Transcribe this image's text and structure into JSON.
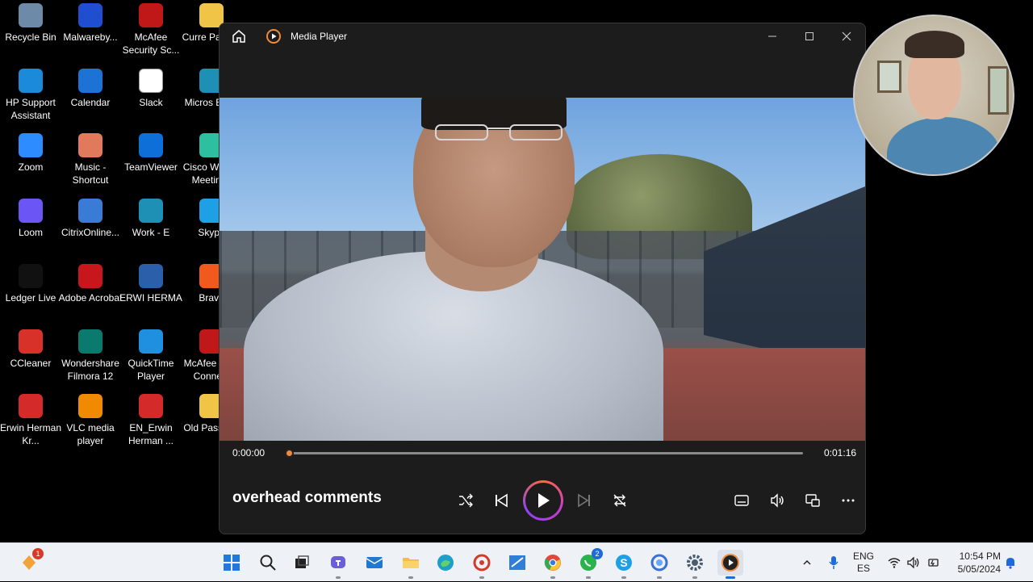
{
  "desktop": {
    "icons": [
      {
        "label": "Recycle Bin",
        "icon": "recycle-bin-icon",
        "color": "#6d8ba8"
      },
      {
        "label": "Malwareby...",
        "icon": "malwarebytes-icon",
        "color": "#1f4fd0"
      },
      {
        "label": "McAfee Security Sc...",
        "icon": "mcafee-icon",
        "color": "#c01818"
      },
      {
        "label": "Curre Passsp",
        "icon": "folder-icon",
        "color": "#f0c447"
      },
      {
        "label": "HP Support Assistant",
        "icon": "hp-support-icon",
        "color": "#1b8ad8"
      },
      {
        "label": "Calendar",
        "icon": "calendar-icon",
        "color": "#1d72d6"
      },
      {
        "label": "Slack",
        "icon": "slack-icon",
        "color": "#ffffff"
      },
      {
        "label": "Micros Edge",
        "icon": "edge-icon",
        "color": "#1e8fb5"
      },
      {
        "label": "Zoom",
        "icon": "zoom-icon",
        "color": "#2d8cff"
      },
      {
        "label": "Music - Shortcut",
        "icon": "music-folder-icon",
        "color": "#e07a5a"
      },
      {
        "label": "TeamViewer",
        "icon": "teamviewer-icon",
        "color": "#0e6fd8"
      },
      {
        "label": "Cisco Webex Meetings",
        "icon": "webex-icon",
        "color": "#2cc0a0"
      },
      {
        "label": "Loom",
        "icon": "loom-icon",
        "color": "#6c55f5"
      },
      {
        "label": "CitrixOnline...",
        "icon": "citrix-icon",
        "color": "#3a7bd5"
      },
      {
        "label": "Work - E",
        "icon": "edge-work-icon",
        "color": "#1e8fb5"
      },
      {
        "label": "Skype",
        "icon": "skype-icon",
        "color": "#1da0e6"
      },
      {
        "label": "Ledger Live",
        "icon": "ledger-icon",
        "color": "#111111"
      },
      {
        "label": "Adobe Acrobat",
        "icon": "acrobat-icon",
        "color": "#c8161d"
      },
      {
        "label": "ERWI HERMA",
        "icon": "word-doc-icon",
        "color": "#2b5faa"
      },
      {
        "label": "Brave",
        "icon": "brave-icon",
        "color": "#f25a1d"
      },
      {
        "label": "CCleaner",
        "icon": "ccleaner-icon",
        "color": "#d8312a"
      },
      {
        "label": "Wondershare Filmora 12",
        "icon": "filmora-icon",
        "color": "#0a7a6e"
      },
      {
        "label": "QuickTime Player",
        "icon": "quicktime-icon",
        "color": "#1f8fe0"
      },
      {
        "label": "McAfee Safe Connect",
        "icon": "mcafee-safe-icon",
        "color": "#c01818"
      },
      {
        "label": "Erwin Herman Kr...",
        "icon": "pdf-icon",
        "color": "#d42a2a"
      },
      {
        "label": "VLC media player",
        "icon": "vlc-icon",
        "color": "#f08a00"
      },
      {
        "label": "EN_Erwin Herman ...",
        "icon": "pdf-icon",
        "color": "#d42a2a"
      },
      {
        "label": "Old Passport",
        "icon": "folder-icon",
        "color": "#f0c447"
      }
    ]
  },
  "player": {
    "window_title": "Media Player",
    "current_time": "0:00:00",
    "duration": "0:01:16",
    "progress": 0.0,
    "media_title": "overhead comments",
    "accent": "#f08a3c"
  },
  "taskbar": {
    "notification_badge": "1",
    "whatsapp_badge": "2",
    "language_top": "ENG",
    "language_bottom": "ES",
    "time": "10:54 PM",
    "date": "5/05/2024"
  }
}
